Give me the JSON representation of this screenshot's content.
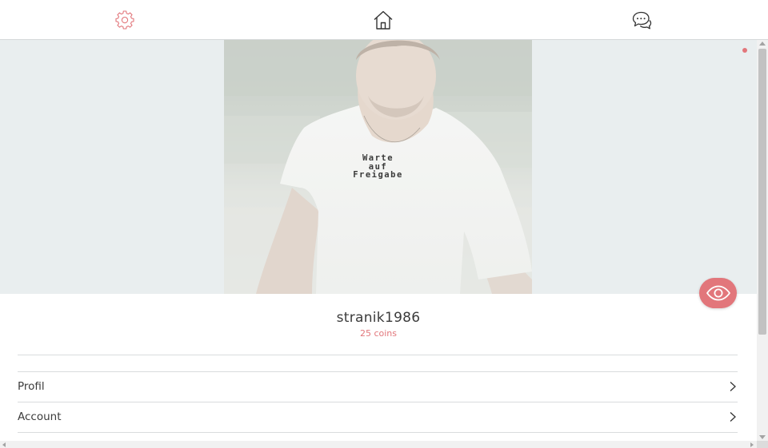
{
  "nav": {
    "settings_icon": "gear-icon",
    "home_icon": "home-icon",
    "chat_icon": "chat-bubbles-icon",
    "settings_color": "#e2767b"
  },
  "profile": {
    "photo_status_text": [
      "Warte",
      "auf",
      "Freigabe"
    ],
    "username": "stranik1986",
    "coins": "25 coins"
  },
  "menu": {
    "items": [
      {
        "label": "Profil"
      },
      {
        "label": "Account"
      }
    ]
  },
  "colors": {
    "accent": "#e2767b",
    "photo_background": "#e9eeef",
    "text": "#3b3b3b"
  }
}
